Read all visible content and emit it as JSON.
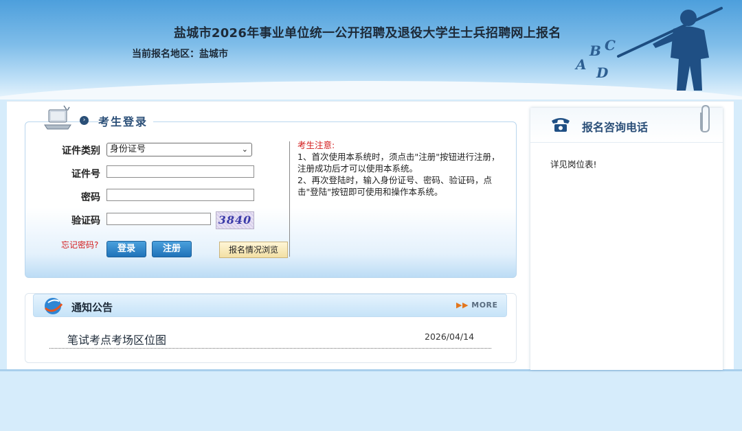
{
  "header": {
    "title": "盐城市2026年事业单位统一公开招聘及退役大学生士兵招聘网上报名",
    "region_label": "当前报名地区：盐城市",
    "logo_letters": "ABCD"
  },
  "login": {
    "title": "考生登录",
    "id_type_label": "证件类别",
    "id_type_value": "身份证号",
    "id_number_label": "证件号",
    "id_number_value": "",
    "password_label": "密码",
    "password_value": "",
    "captcha_label": "验证码",
    "captcha_value": "",
    "captcha_text": "3840",
    "forgot_link": "忘记密码?",
    "login_button": "登录",
    "register_button": "注册",
    "browse_button": "报名情况浏览"
  },
  "notice": {
    "title": "考生注意:",
    "item1": "1、首次使用本系统时，须点击\"注册\"按钮进行注册，注册成功后才可以使用本系统。",
    "item2": "2、再次登陆时，输入身份证号、密码、验证码，点击\"登陆\"按钮即可使用和操作本系统。"
  },
  "announcements": {
    "title": "通知公告",
    "more_label": "MORE",
    "items": [
      {
        "title": "笔试考点考场区位图",
        "date": "2026/04/14"
      }
    ]
  },
  "consult": {
    "title": "报名咨询电话",
    "text": "详见岗位表!"
  },
  "colors": {
    "header_blue": "#4d9fdc",
    "button_blue": "#1f73b9",
    "alert_red": "#d31b1b",
    "page_bg": "#d6ecfb"
  }
}
